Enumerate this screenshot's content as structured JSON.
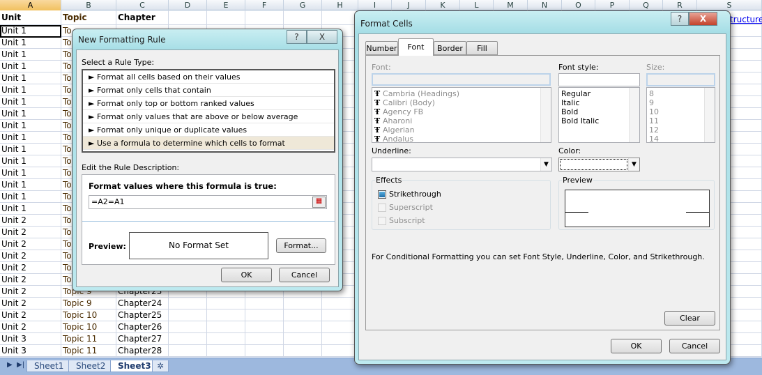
{
  "sheet": {
    "columns": [
      "A",
      "B",
      "C",
      "D",
      "E",
      "F",
      "G",
      "H",
      "I",
      "J",
      "K",
      "L",
      "M",
      "N",
      "O",
      "P",
      "Q",
      "R",
      "S"
    ],
    "selected_column": "A",
    "header_row": [
      "Unit",
      "Topic",
      "Chapter"
    ],
    "rows": [
      [
        "Unit 1",
        "To",
        ""
      ],
      [
        "Unit 1",
        "To",
        ""
      ],
      [
        "Unit 1",
        "To",
        ""
      ],
      [
        "Unit 1",
        "To",
        ""
      ],
      [
        "Unit 1",
        "To",
        ""
      ],
      [
        "Unit 1",
        "To",
        ""
      ],
      [
        "Unit 1",
        "To",
        ""
      ],
      [
        "Unit 1",
        "To",
        ""
      ],
      [
        "Unit 1",
        "To",
        ""
      ],
      [
        "Unit 1",
        "To",
        ""
      ],
      [
        "Unit 1",
        "To",
        ""
      ],
      [
        "Unit 1",
        "To",
        ""
      ],
      [
        "Unit 1",
        "To",
        ""
      ],
      [
        "Unit 1",
        "To",
        ""
      ],
      [
        "Unit 1",
        "To",
        ""
      ],
      [
        "Unit 1",
        "To",
        ""
      ],
      [
        "Unit 2",
        "To",
        ""
      ],
      [
        "Unit 2",
        "To",
        ""
      ],
      [
        "Unit 2",
        "To",
        ""
      ],
      [
        "Unit 2",
        "To",
        ""
      ],
      [
        "Unit 2",
        "To",
        ""
      ],
      [
        "Unit 2",
        "To",
        ""
      ],
      [
        "Unit 2",
        "Topic 9",
        "Chapter23"
      ],
      [
        "Unit 2",
        "Topic 9",
        "Chapter24"
      ],
      [
        "Unit 2",
        "Topic 10",
        "Chapter25"
      ],
      [
        "Unit 2",
        "Topic 10",
        "Chapter26"
      ],
      [
        "Unit 3",
        "Topic 11",
        "Chapter27"
      ],
      [
        "Unit 3",
        "Topic 11",
        "Chapter28"
      ]
    ],
    "link_fragment": "tructure-",
    "sheet_tabs": [
      "Sheet1",
      "Sheet2",
      "Sheet3"
    ],
    "active_tab": "Sheet3"
  },
  "rule_dialog": {
    "title": "New Formatting Rule",
    "help": "?",
    "close": "X",
    "select_label": "Select a Rule Type:",
    "rule_types": [
      "► Format all cells based on their values",
      "► Format only cells that contain",
      "► Format only top or bottom ranked values",
      "► Format only values that are above or below average",
      "► Format only unique or duplicate values",
      "► Use a formula to determine which cells to format"
    ],
    "selected_rule": 5,
    "edit_label": "Edit the Rule Description:",
    "formula_label": "Format values where this formula is true:",
    "formula_value": "=A2=A1",
    "preview_label": "Preview:",
    "preview_text": "No Format Set",
    "format_button": "Format...",
    "ok": "OK",
    "cancel": "Cancel"
  },
  "format_cells": {
    "title": "Format Cells",
    "help": "?",
    "close": "X",
    "tabs": [
      "Number",
      "Font",
      "Border",
      "Fill"
    ],
    "active_tab": "Font",
    "font_label": "Font:",
    "font_value": "",
    "fonts": [
      "Cambria (Headings)",
      "Calibri (Body)",
      "Agency FB",
      "Aharoni",
      "Algerian",
      "Andalus"
    ],
    "style_label": "Font style:",
    "style_value": "",
    "styles": [
      "Regular",
      "Italic",
      "Bold",
      "Bold Italic"
    ],
    "size_label": "Size:",
    "size_value": "",
    "sizes": [
      "8",
      "9",
      "10",
      "11",
      "12",
      "14"
    ],
    "underline_label": "Underline:",
    "underline_value": "",
    "color_label": "Color:",
    "effects_label": "Effects",
    "strikethrough": {
      "label": "Strikethrough",
      "checked": "indeterminate"
    },
    "superscript": {
      "label": "Superscript",
      "enabled": false
    },
    "subscript": {
      "label": "Subscript",
      "enabled": false
    },
    "preview_label": "Preview",
    "note": "For Conditional Formatting you can set Font Style, Underline, Color, and Strikethrough.",
    "clear": "Clear",
    "ok": "OK",
    "cancel": "Cancel"
  }
}
